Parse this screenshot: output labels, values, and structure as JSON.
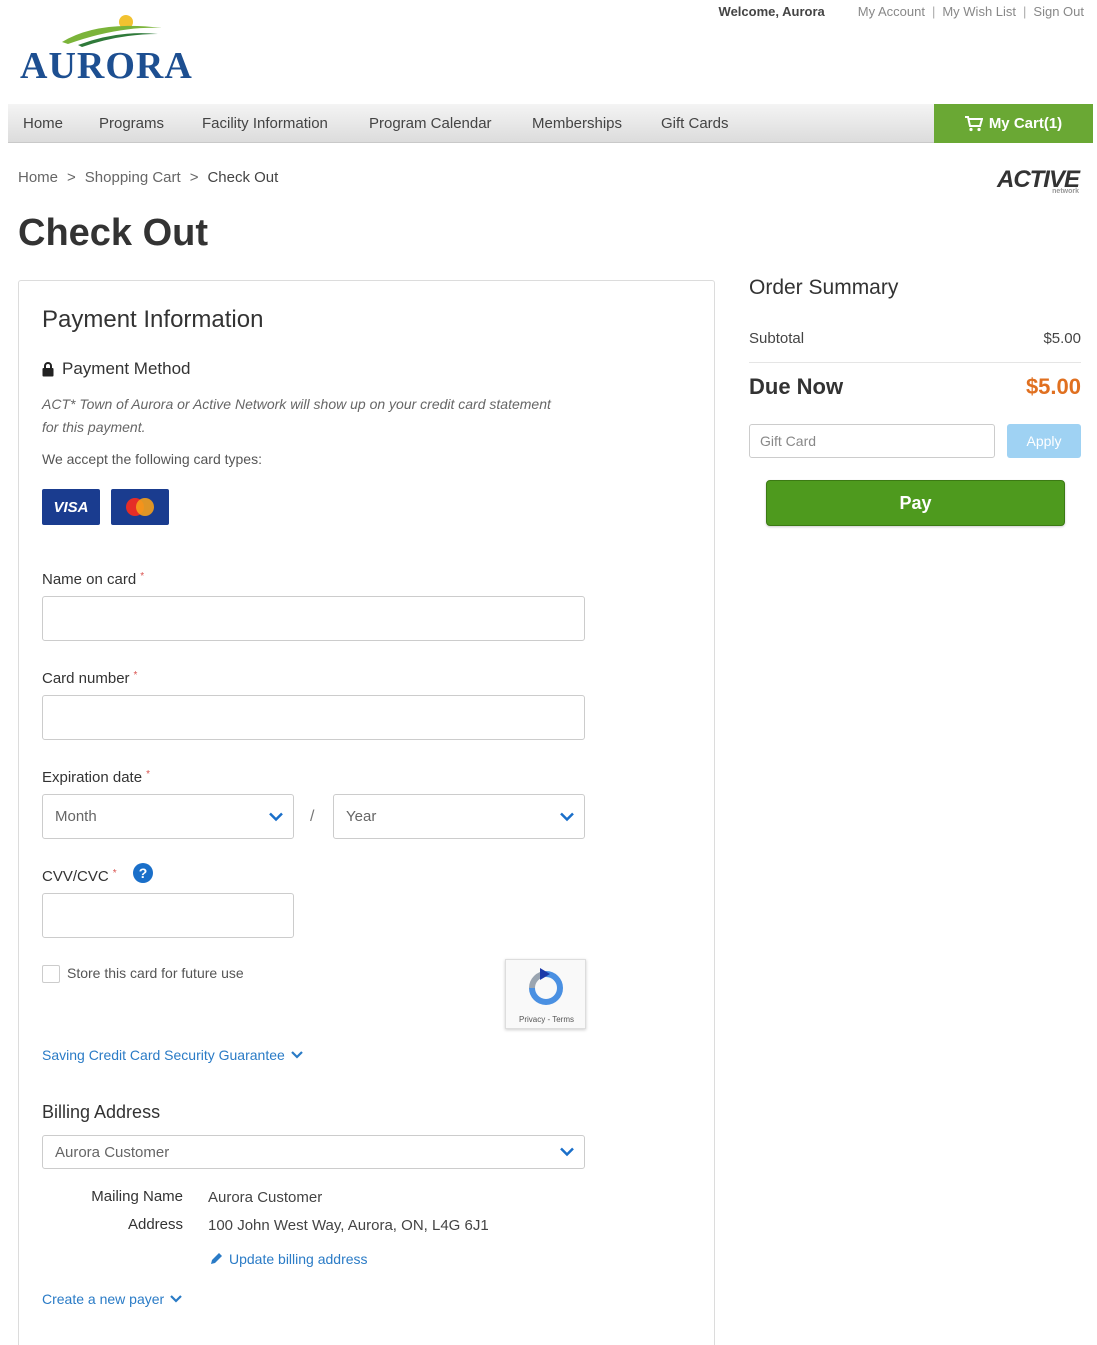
{
  "brand": {
    "name": "AURORA"
  },
  "toplinks": {
    "welcome": "Welcome, Aurora",
    "my_account": "My Account",
    "wish_list": "My Wish List",
    "sign_out": "Sign Out",
    "sep": "|"
  },
  "nav": {
    "items": [
      "Home",
      "Programs",
      "Facility Information",
      "Program Calendar",
      "Memberships",
      "Gift Cards"
    ],
    "cart": "My Cart(1)"
  },
  "breadcrumb": {
    "items": [
      "Home",
      "Shopping Cart",
      "Check Out"
    ],
    "sep": ">"
  },
  "partner_logo": {
    "text": "ACTIVE",
    "sub": "network"
  },
  "page_title": "Check Out",
  "payment": {
    "heading": "Payment Information",
    "method_label": "Payment Method",
    "note": "ACT* Town of Aurora or Active Network will show up on your credit card statement for this payment.",
    "accept_label": "We accept the following card types:",
    "cards": [
      "VISA",
      "Mastercard"
    ],
    "name_label": "Name on card",
    "number_label": "Card number",
    "expiry_label": "Expiration date",
    "month_placeholder": "Month",
    "year_placeholder": "Year",
    "expiry_sep": "/",
    "cvv_label": "CVV/CVC",
    "help_glyph": "?",
    "required_mark": "*",
    "store_card_label": "Store this card for future use",
    "recaptcha_text": "Privacy - Terms",
    "guarantee_link": "Saving Credit Card Security Guarantee"
  },
  "billing": {
    "heading": "Billing Address",
    "selected_payer": "Aurora Customer",
    "mailing_name_label": "Mailing Name",
    "mailing_name_value": "Aurora Customer",
    "address_label": "Address",
    "address_value": "100 John West Way, Aurora, ON, L4G 6J1",
    "update_link": "Update billing address",
    "new_payer_link": "Create a new payer"
  },
  "summary": {
    "heading": "Order Summary",
    "subtotal_label": "Subtotal",
    "subtotal_value": "$5.00",
    "due_label": "Due Now",
    "due_value": "$5.00",
    "gift_placeholder": "Gift Card",
    "apply_label": "Apply",
    "pay_label": "Pay"
  },
  "colors": {
    "cart_green": "#6aa834",
    "pay_green": "#4e9a1e",
    "link_blue": "#2a7bc6",
    "due_orange": "#e07020",
    "visa_blue": "#1a3c8f"
  }
}
